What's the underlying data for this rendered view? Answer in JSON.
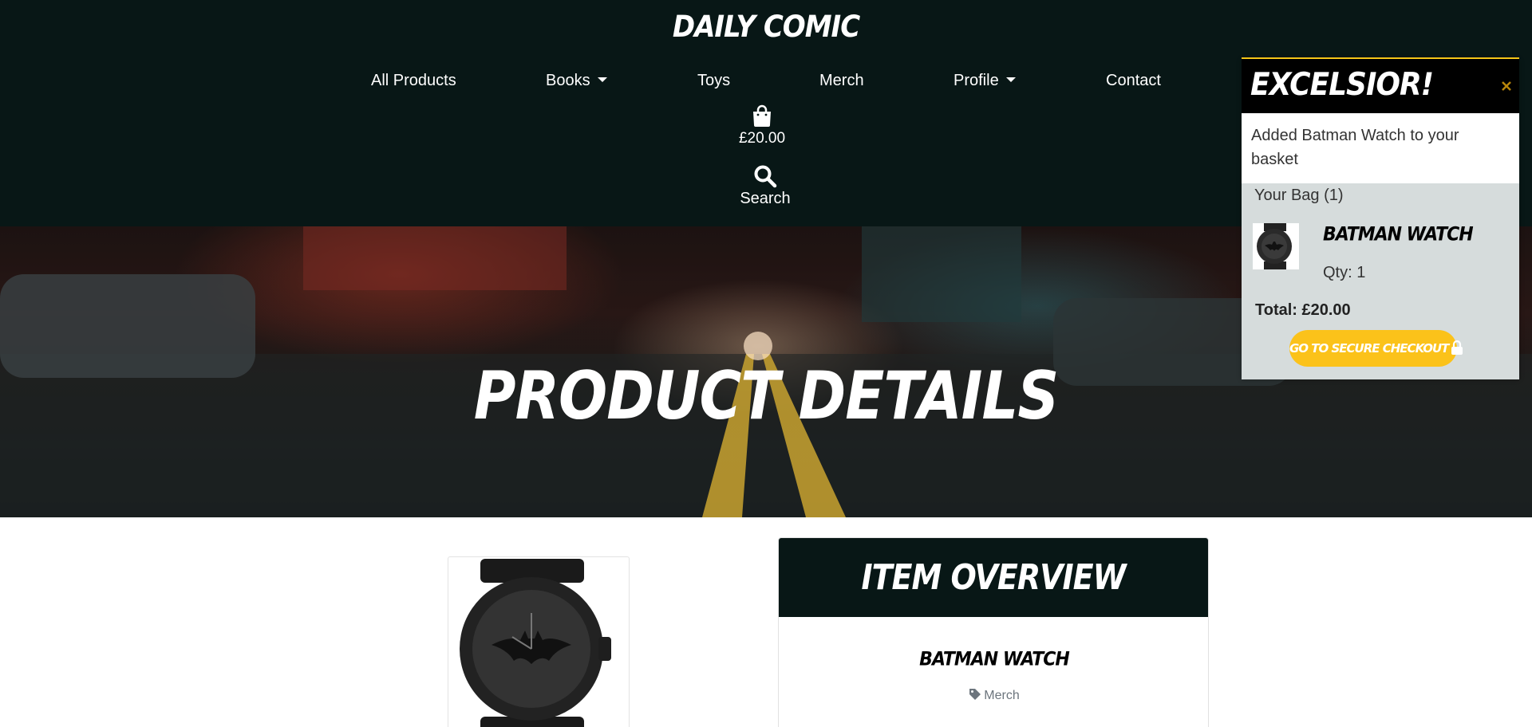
{
  "brand": "Daily Comic",
  "nav": {
    "items": [
      {
        "label": "All Products"
      },
      {
        "label": "Books"
      },
      {
        "label": "Toys"
      },
      {
        "label": "Merch"
      },
      {
        "label": "Profile"
      },
      {
        "label": "Contact"
      }
    ],
    "bag_total": "£20.00",
    "search_label": "Search",
    "icons": {
      "bag": "shopping-bag-icon",
      "search": "search-icon"
    }
  },
  "hero": {
    "title": "Product Details"
  },
  "product": {
    "overview_title": "Item Overview",
    "name": "Batman Watch",
    "category": "Merch"
  },
  "toast": {
    "title": "Excelsior!",
    "message": "Added Batman Watch to your basket",
    "bag_label": "Your Bag (1)",
    "item_name": "Batman Watch",
    "qty": "Qty: 1",
    "total": "Total: £20.00",
    "checkout_label": "Go to secure checkout"
  },
  "colors": {
    "header_bg": "#081716",
    "accent": "#fbc21a",
    "toast_bg": "#d6dcdc"
  }
}
